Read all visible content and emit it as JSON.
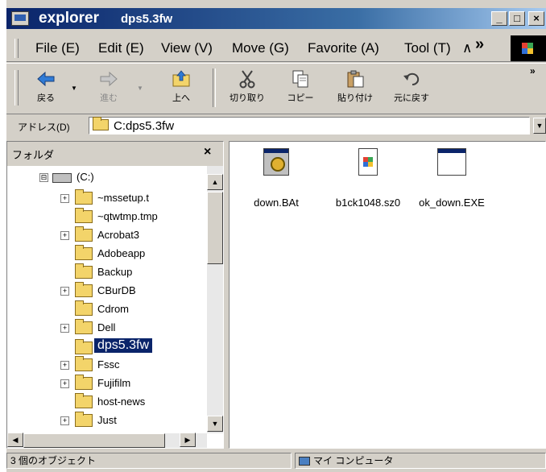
{
  "window": {
    "app_title": "explorer",
    "path_title": "dps5.3fw",
    "buttons": {
      "minimize": "_",
      "maximize": "□",
      "close": "×"
    }
  },
  "menu": {
    "items": [
      "File (E)",
      "Edit (E)",
      "View (V)",
      "Move (G)",
      "Favorite (A)",
      "Tool (T)",
      "∧"
    ],
    "more": "»"
  },
  "toolbar": {
    "more": "»",
    "buttons": [
      {
        "label": "戻る",
        "icon": "back-arrow-icon",
        "enabled": true
      },
      {
        "label": "進む",
        "icon": "forward-arrow-icon",
        "enabled": false
      },
      {
        "label": "上へ",
        "icon": "up-folder-icon",
        "enabled": true
      },
      {
        "label": "切り取り",
        "icon": "scissors-icon",
        "enabled": true
      },
      {
        "label": "コピー",
        "icon": "copy-icon",
        "enabled": true
      },
      {
        "label": "貼り付け",
        "icon": "paste-icon",
        "enabled": true
      },
      {
        "label": "元に戻す",
        "icon": "undo-icon",
        "enabled": true
      }
    ]
  },
  "address": {
    "label": "アドレス(D)",
    "value": "C:dps5.3fw"
  },
  "folders": {
    "title": "フォルダ",
    "close": "×",
    "tree": [
      {
        "label": "(C:)",
        "level": 0,
        "expander": "⊟",
        "type": "drive"
      },
      {
        "label": "~mssetup.t",
        "level": 1,
        "expander": "+"
      },
      {
        "label": "~qtwtmp.tmp",
        "level": 1,
        "expander": ""
      },
      {
        "label": "Acrobat3",
        "level": 1,
        "expander": "+"
      },
      {
        "label": "Adobeapp",
        "level": 1,
        "expander": ""
      },
      {
        "label": "Backup",
        "level": 1,
        "expander": ""
      },
      {
        "label": "CBurDB",
        "level": 1,
        "expander": "+"
      },
      {
        "label": "Cdrom",
        "level": 1,
        "expander": ""
      },
      {
        "label": "Dell",
        "level": 1,
        "expander": "+"
      },
      {
        "label": "dps5.3fw",
        "level": 1,
        "expander": "",
        "selected": true
      },
      {
        "label": "Fssc",
        "level": 1,
        "expander": "+"
      },
      {
        "label": "Fujifilm",
        "level": 1,
        "expander": "+"
      },
      {
        "label": "host-news",
        "level": 1,
        "expander": ""
      },
      {
        "label": "Just",
        "level": 1,
        "expander": "+"
      }
    ]
  },
  "files": [
    {
      "name": "down.BAt",
      "icon": "batch-file-icon"
    },
    {
      "name": "b1ck1048.sz0",
      "icon": "document-icon"
    },
    {
      "name": "ok_down.EXE",
      "icon": "executable-icon"
    }
  ],
  "status": {
    "left": "3 個のオブジェクト",
    "right": "マイ コンピュータ"
  },
  "colors": {
    "selection": "#0a246a",
    "titlebar": "#0a246a",
    "face": "#d4d0c8"
  }
}
